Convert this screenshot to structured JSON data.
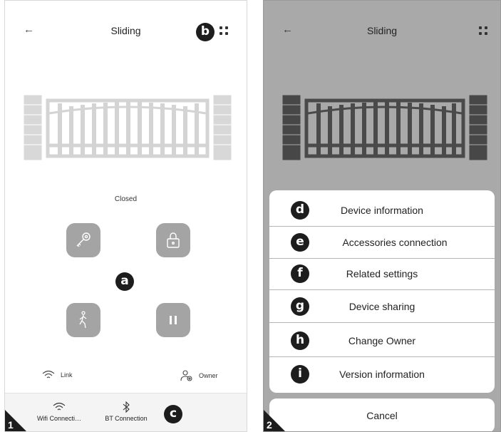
{
  "screen1": {
    "header": {
      "back": "←",
      "title": "Sliding"
    },
    "badge_b": "b",
    "status": "Closed",
    "badge_a": "a",
    "info": {
      "link_label": "Link",
      "owner_label": "Owner"
    },
    "tabs": [
      {
        "label": "Wifi Connecti…",
        "icon": "wifi-icon"
      },
      {
        "label": "BT Connection",
        "icon": "bluetooth-icon"
      }
    ],
    "badge_c": "c",
    "corner_number": "1"
  },
  "screen2": {
    "header": {
      "back": "←",
      "title": "Sliding"
    },
    "menu": [
      {
        "badge": "d",
        "label": "Device information"
      },
      {
        "badge": "e",
        "label": "Accessories connection"
      },
      {
        "badge": "f",
        "label": "Related settings"
      },
      {
        "badge": "g",
        "label": "Device sharing"
      },
      {
        "badge": "h",
        "label": "Change Owner"
      },
      {
        "badge": "i",
        "label": "Version information"
      }
    ],
    "cancel": "Cancel",
    "corner_number": "2"
  },
  "colors": {
    "control_grey": "#a4a4a4",
    "overlay_grey": "#a9a9a9",
    "badge_black": "#1d1d1d"
  }
}
